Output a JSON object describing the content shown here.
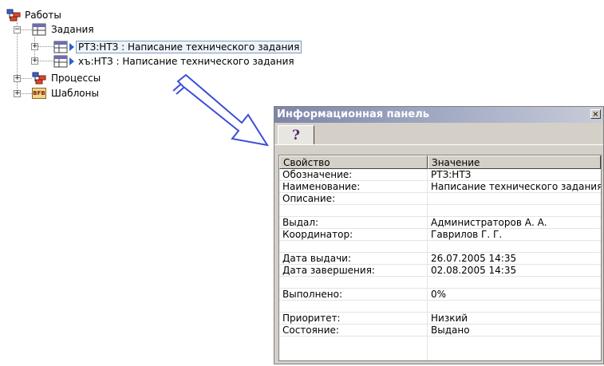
{
  "tree": {
    "root": {
      "label": "Работы",
      "icon": "hierarchy-icon"
    },
    "tasks": {
      "label": "Задания",
      "expander": "−",
      "icon": "table-window-icon"
    },
    "task1": {
      "label": "РТЗ:НТЗ : Написание технического задания",
      "expander": "+",
      "icon": "table-window-icon",
      "selected": true
    },
    "task2": {
      "label": "хъ:НТЗ : Написание технического задания",
      "expander": "+",
      "icon": "table-window-icon"
    },
    "processes": {
      "label": "Процессы",
      "expander": "+",
      "icon": "hierarchy-icon"
    },
    "templates": {
      "label": "Шаблоны",
      "expander": "+",
      "icon": "template-icon",
      "icon_text": "BFB"
    }
  },
  "panel": {
    "title": "Информационная панель",
    "close_symbol": "×",
    "tab_label": "?",
    "columns": [
      "Свойство",
      "Значение"
    ],
    "rows": [
      {
        "property": "Обозначение:",
        "value": "РТЗ:НТЗ"
      },
      {
        "property": "Наименование:",
        "value": "Написание технического задания"
      },
      {
        "property": "Описание:",
        "value": ""
      },
      {
        "property": "",
        "value": ""
      },
      {
        "property": "Выдал:",
        "value": "Администраторов А. А."
      },
      {
        "property": "Координатор:",
        "value": "Гаврилов Г. Г."
      },
      {
        "property": "",
        "value": ""
      },
      {
        "property": "Дата выдачи:",
        "value": "26.07.2005 14:35"
      },
      {
        "property": "Дата завершения:",
        "value": "02.08.2005 14:35"
      },
      {
        "property": "",
        "value": ""
      },
      {
        "property": "Выполнено:",
        "value": "0%"
      },
      {
        "property": "",
        "value": ""
      },
      {
        "property": "Приоритет:",
        "value": "Низкий"
      },
      {
        "property": "Состояние:",
        "value": "Выдано"
      }
    ]
  },
  "colors": {
    "title_gradient_start": "#7e86a8",
    "arrow_outline": "#3a4fd8",
    "tab_glyph": "#5a2a78"
  }
}
